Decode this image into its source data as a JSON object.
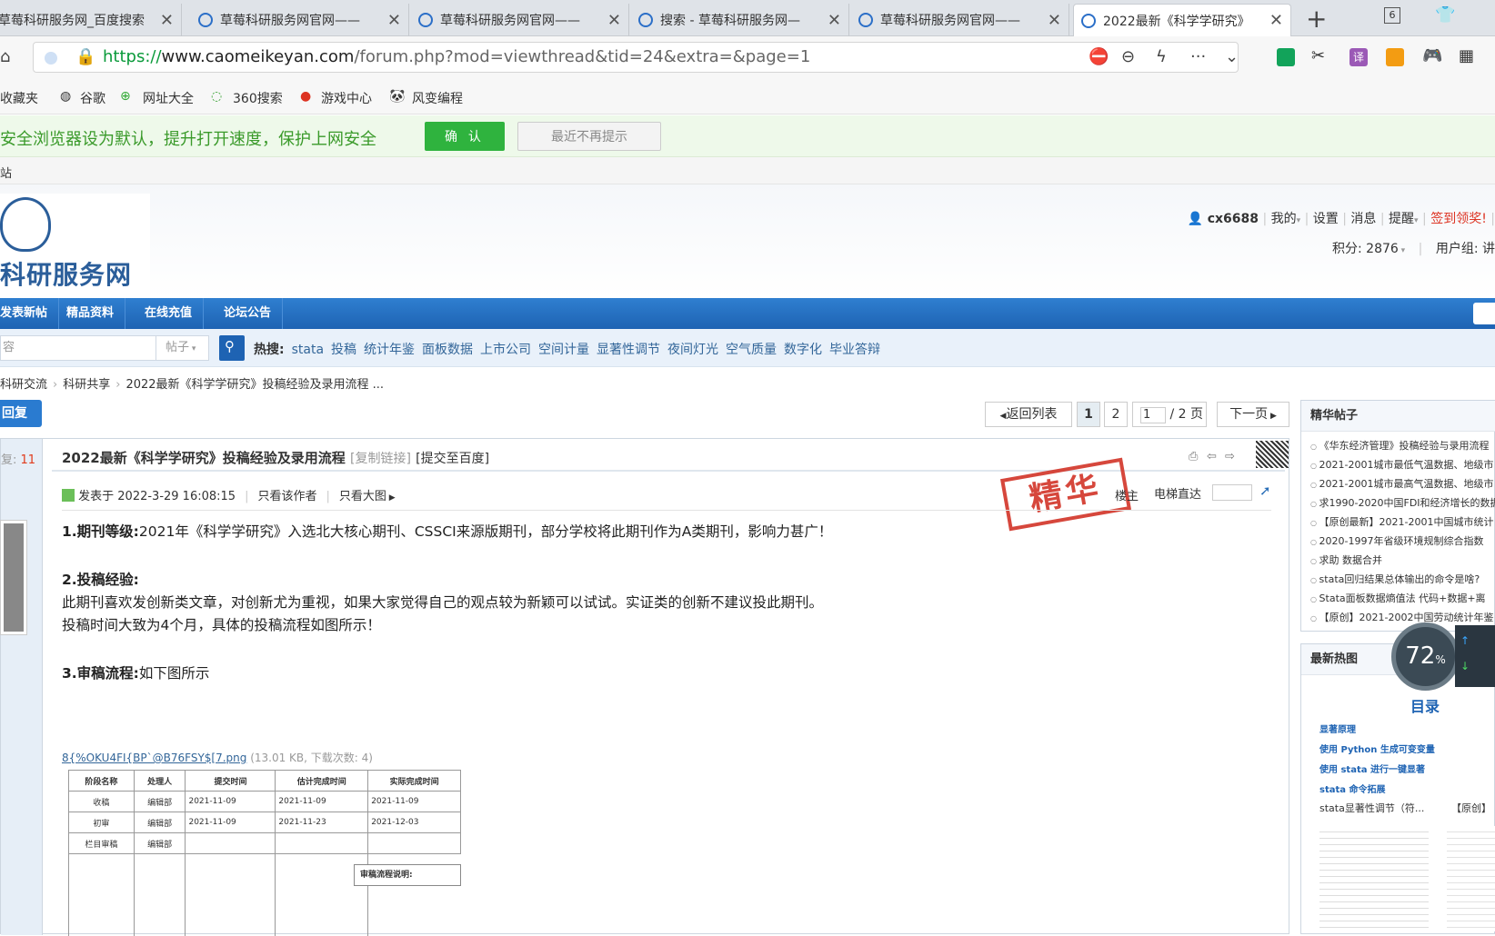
{
  "tabs": [
    {
      "title": "草莓科研服务网_百度搜索",
      "active": false
    },
    {
      "title": "草莓科研服务网官网——",
      "active": false
    },
    {
      "title": "草莓科研服务网官网——",
      "active": false
    },
    {
      "title": "搜索 - 草莓科研服务网—",
      "active": false
    },
    {
      "title": "草莓科研服务网官网——",
      "active": false
    },
    {
      "title": "2022最新《科学学研究》",
      "active": true
    }
  ],
  "tab_count": "6",
  "address": {
    "scheme": "https://",
    "host": "www.caomeikeyan.com",
    "path": "/forum.php?mod=viewthread&tid=24&extra=&page=1"
  },
  "bookmarks": [
    "收藏夹",
    "谷歌",
    "网址大全",
    "360搜索",
    "游戏中心",
    "风变编程"
  ],
  "notice": {
    "text": "安全浏览器设为默认，提升打开速度，保护上网安全",
    "confirm": "确 认",
    "dismiss": "最近不再提示"
  },
  "smallbar": "站",
  "logo_text": "科研服务网",
  "user": {
    "name": "cx6688",
    "mine": "我的",
    "settings": "设置",
    "messages": "消息",
    "remind": "提醒",
    "signin": "签到领奖!",
    "score": "积分: 2876",
    "group": "用户组: 讲"
  },
  "nav": [
    "发表新帖",
    "精品资料",
    "在线充值",
    "论坛公告"
  ],
  "search": {
    "placeholder": "容",
    "type": "帖子",
    "hot_label": "热搜:",
    "hot": [
      "stata",
      "投稿",
      "统计年鉴",
      "面板数据",
      "上市公司",
      "空间计量",
      "显著性调节",
      "夜间灯光",
      "空气质量",
      "数字化",
      "毕业答辩"
    ]
  },
  "breadcrumb": [
    "科研交流",
    "科研共享",
    "2022最新《科学学研究》投稿经验及录用流程 ..."
  ],
  "reply_btn": "回复",
  "pager": {
    "back": "返回列表",
    "p1": "1",
    "p2": "2",
    "input": "1",
    "total": "/ 2 页",
    "next": "下一页"
  },
  "post": {
    "replies_label": "复:",
    "replies": "11",
    "title": "2022最新《科学学研究》投稿经验及录用流程",
    "copy_link": "[复制链接]",
    "submit_baidu": "[提交至百度]",
    "posted": "发表于 2022-3-29 16:08:15",
    "only_author": "只看该作者",
    "big_img": "只看大图",
    "stamp": "精华",
    "floor": "楼主",
    "elevator": "电梯直达",
    "p1_label": "1.期刊等级:",
    "p1": "2021年《科学学研究》入选北大核心期刊、CSSCI来源版期刊，部分学校将此期刊作为A类期刊，影响力甚广！",
    "p2_label": "2.投稿经验:",
    "p2a": "此期刊喜欢发创新类文章，对创新尤为重视，如果大家觉得自己的观点较为新颖可以试试。实证类的创新不建议投此期刊。",
    "p2b": "投稿时间大致为4个月，具体的投稿流程如图所示！",
    "p3_label": "3.审稿流程:",
    "p3": "如下图所示",
    "attach_name": "8{%OKU4FI{BP`@B76FSY$[7.png",
    "attach_info": "(13.01 KB, 下载次数: 4)"
  },
  "flow_table": {
    "headers": [
      "阶段名称",
      "处理人",
      "提交时间",
      "估计完成时间",
      "实际完成时间"
    ],
    "rows": [
      [
        "收稿",
        "编辑部",
        "2021-11-09",
        "2021-11-09",
        "2021-11-09"
      ],
      [
        "初审",
        "编辑部",
        "2021-11-09",
        "2021-11-23",
        "2021-12-03"
      ],
      [
        "栏目审稿",
        "编辑部",
        "",
        "",
        ""
      ]
    ],
    "note": "审稿流程说明:"
  },
  "side1": {
    "title": "精华帖子",
    "items": [
      "《华东经济管理》投稿经验与录用流程",
      "2021-2001城市最低气温数据、地级市",
      "2021-2001城市最高气温数据、地级市",
      "求1990-2020中国FDI和经济增长的数据",
      "【原创最新】2021-2001中国城市统计",
      "2020-1997年省级环境规制综合指数",
      "求助 数据合并",
      "stata回归结果总体输出的命令是啥?",
      "Stata面板数据熵值法 代码+数据+离",
      "【原创】2021-2002中国劳动统计年鉴"
    ]
  },
  "side2": {
    "title": "最新热图",
    "links": [
      "显著原理",
      "使用 Python 生成可变变量",
      "使用 stata 进行一键显著",
      "stata 命令拓展"
    ],
    "cap1": "stata显著性调节（符...",
    "cap2": "【原创】",
    "toc": "目录"
  },
  "gauge": {
    "value": "72",
    "unit": "%"
  }
}
